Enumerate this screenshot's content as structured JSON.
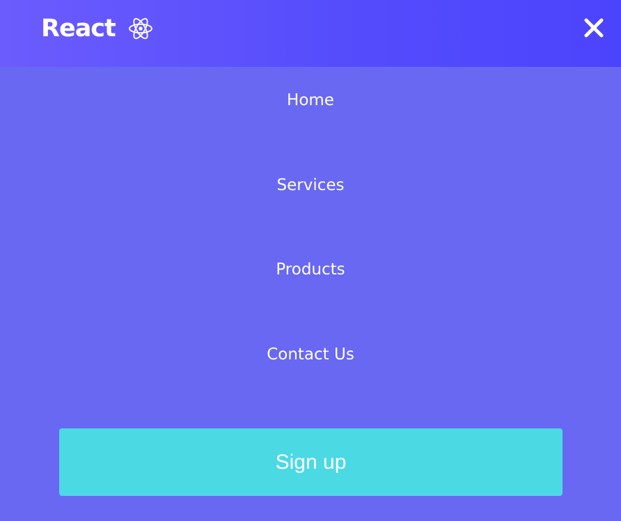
{
  "navbar": {
    "brand_label": "React",
    "brand_icon": "react-atom-icon",
    "close_icon": "close-icon"
  },
  "menu": {
    "items": [
      {
        "label": "Home"
      },
      {
        "label": "Services"
      },
      {
        "label": "Products"
      },
      {
        "label": "Contact Us"
      }
    ]
  },
  "cta": {
    "signup_label": "Sign up"
  },
  "colors": {
    "page_background": "#6868f2",
    "navbar_gradient_start": "#6b5cfd",
    "navbar_gradient_end": "#4b44fd",
    "button_background": "#4bd9e4",
    "text": "#ffffff"
  }
}
